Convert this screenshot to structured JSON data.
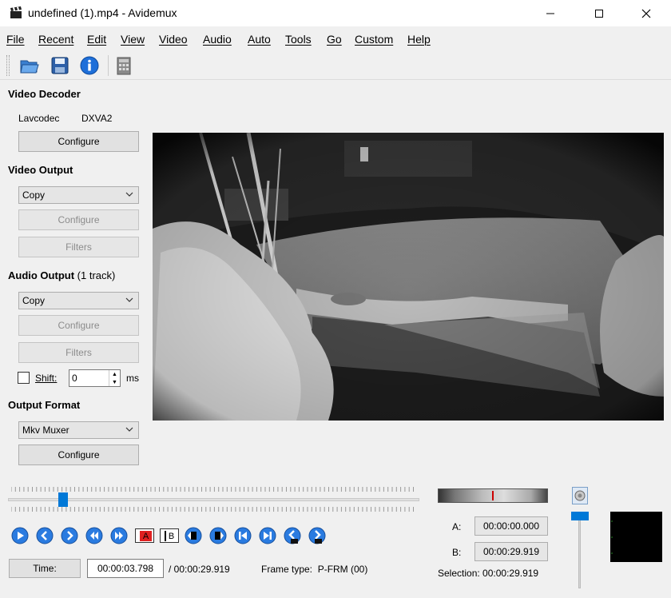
{
  "window": {
    "title": "undefined (1).mp4 - Avidemux",
    "app_icon": "clapperboard-icon",
    "controls": [
      "minimize-icon",
      "maximize-icon",
      "close-icon"
    ]
  },
  "menu": [
    "File",
    "Recent",
    "Edit",
    "View",
    "Video",
    "Audio",
    "Auto",
    "Tools",
    "Go",
    "Custom",
    "Help"
  ],
  "toolbar": {
    "icons": [
      "open-folder-icon",
      "save-icon",
      "info-icon",
      "calculator-icon"
    ]
  },
  "video_decoder": {
    "title": "Video Decoder",
    "decoder": "Lavcodec",
    "hw": "DXVA2",
    "configure": "Configure"
  },
  "video_output": {
    "title": "Video Output",
    "codec": "Copy",
    "configure": "Configure",
    "filters": "Filters"
  },
  "audio_output": {
    "title": "Audio Output",
    "tracks": "(1 track)",
    "codec": "Copy",
    "configure": "Configure",
    "filters": "Filters",
    "shift_label": "Shift:",
    "shift_value": "0",
    "shift_unit": "ms"
  },
  "output_format": {
    "title": "Output Format",
    "muxer": "Mkv Muxer",
    "configure": "Configure"
  },
  "timeline": {
    "position_fraction": 0.127
  },
  "navigation": {
    "buttons": [
      "play-icon",
      "previous-frame-icon",
      "next-frame-icon",
      "previous-keyframe-icon",
      "next-keyframe-icon",
      "set-marker-a-icon",
      "set-marker-b-icon",
      "previous-black-frame-icon",
      "next-black-frame-icon",
      "goto-first-frame-icon",
      "goto-last-frame-icon",
      "goto-marker-a-icon",
      "goto-marker-b-icon"
    ],
    "marker_a_text": "A",
    "marker_b_text": "B"
  },
  "status": {
    "time_button": "Time:",
    "current_time": "00:00:03.798",
    "total_time": "/ 00:00:29.919",
    "frame_type": "Frame type:  P-FRM (00)"
  },
  "selection": {
    "a_label": "A:",
    "a_value": "00:00:00.000",
    "b_label": "B:",
    "b_value": "00:00:29.919",
    "selection_text": "Selection: 00:00:29.919"
  },
  "volume": {
    "icon": "speaker-icon",
    "level_fraction": 1.0
  },
  "colors": {
    "accent": "#0078d7",
    "marker_a_bg": "#e02020"
  }
}
